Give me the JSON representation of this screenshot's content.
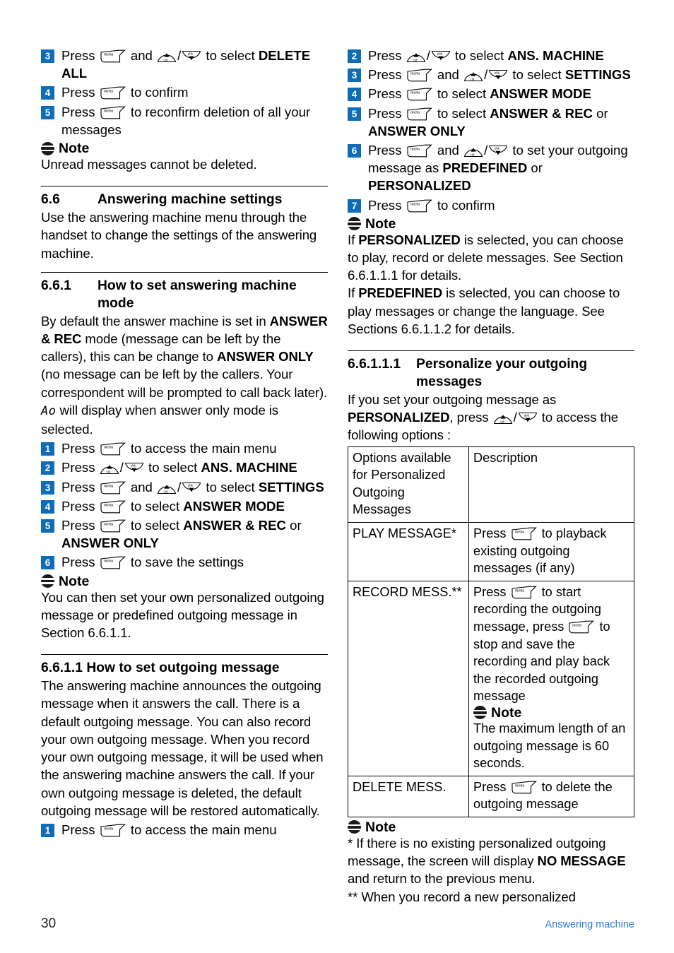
{
  "footer": {
    "page_number": "30",
    "section_label": "Answering machine"
  },
  "icons": {
    "menu_label": "menu",
    "up_label": "cid",
    "down_label": "pbk",
    "slash": "/",
    "note_label": "Note",
    "and": "and"
  },
  "left_column": {
    "steps_delete": [
      {
        "num": "3",
        "pre": "Press ",
        "mid": " and ",
        "post": " to select ",
        "bold": "DELETE ALL"
      },
      {
        "num": "4",
        "pre": "Press ",
        "post": " to confirm"
      },
      {
        "num": "5",
        "pre": "Press ",
        "post": " to reconfirm deletion of all your messages"
      }
    ],
    "note1": {
      "label": "Note",
      "text": "Unread messages cannot be deleted."
    },
    "section_6_6": {
      "number": "6.6",
      "title": "Answering machine settings",
      "body": "Use the answering machine menu through the handset to change the settings of the answering machine."
    },
    "section_6_6_1": {
      "number": "6.6.1",
      "title": "How to set answering machine mode",
      "p1_a": "By default the answer machine is set in ",
      "p1_b": "ANSWER & REC",
      "p1_c": " mode (message can be left by the callers), this can be change to ",
      "p1_d": "ANSWER ONLY",
      "p1_e": " (no message can be left by the callers. Your correspondent will be prompted to call back later).",
      "lcd_glyph": "Ao",
      "p2": " will display when answer only mode is selected."
    },
    "steps_mode": [
      {
        "num": "1",
        "pre": "Press ",
        "post": " to access the main menu"
      },
      {
        "num": "2",
        "pre": "Press ",
        "post": " to select ",
        "bold": "ANS. MACHINE"
      },
      {
        "num": "3",
        "pre": "Press ",
        "mid": " and ",
        "post": " to select ",
        "bold": "SETTINGS"
      },
      {
        "num": "4",
        "pre": "Press ",
        "post": " to select ",
        "bold": "ANSWER MODE"
      },
      {
        "num": "5",
        "pre": "Press ",
        "post": " to select ",
        "bold": "ANSWER & REC",
        "tail": " or ",
        "bold2": "ANSWER ONLY"
      },
      {
        "num": "6",
        "pre": "Press ",
        "post": " to save the settings"
      }
    ],
    "note2": {
      "label": "Note",
      "text": "You can then set your own personalized outgoing message or predefined outgoing message in Section 6.6.1.1."
    },
    "section_6_6_1_1": {
      "number": "6.6.1.1",
      "title": "How to set outgoing message",
      "body": "The answering machine announces the outgoing message when it answers the call. There is a default outgoing message. You can also record your own outgoing message. When you record your own outgoing message, it will be used when the answering machine answers the call. If your own outgoing message is deleted, the default outgoing message will be restored automatically."
    },
    "last_step": {
      "num": "1",
      "pre": "Press ",
      "post": " to access the main menu"
    }
  },
  "right_column": {
    "steps_cont": [
      {
        "num": "2",
        "pre": "Press ",
        "post": " to select ",
        "bold": "ANS. MACHINE"
      },
      {
        "num": "3",
        "pre": "Press ",
        "mid": " and ",
        "post": " to select ",
        "bold": "SETTINGS"
      },
      {
        "num": "4",
        "pre": "Press ",
        "post": " to select ",
        "bold": "ANSWER MODE"
      },
      {
        "num": "5",
        "pre": "Press ",
        "post": " to select ",
        "bold": "ANSWER & REC",
        "tail": " or ",
        "bold2": "ANSWER ONLY"
      },
      {
        "num": "6",
        "pre": "Press ",
        "mid": " and ",
        "post": " to set your outgoing message as ",
        "bold": "PREDEFINED",
        "tail": " or ",
        "bold2": "PERSONALIZED"
      },
      {
        "num": "7",
        "pre": "Press ",
        "post": " to confirm"
      }
    ],
    "note3": {
      "label": "Note",
      "l1_a": "If ",
      "l1_b": "PERSONALIZED",
      "l1_c": " is selected, you can choose to play, record or delete messages. See Section 6.6.1.1.1 for details.",
      "l2_a": "If ",
      "l2_b": "PREDEFINED",
      "l2_c": " is selected, you can choose to play messages or change the language. See Sections 6.6.1.1.2 for details."
    },
    "section_6_6_1_1_1": {
      "number": "6.6.1.1.1",
      "title": "Personalize your outgoing messages",
      "intro_a": "If you set your outgoing message as ",
      "intro_b": "PERSONALIZED",
      "intro_c": ", press ",
      "intro_d": " to access the following options :"
    },
    "table": {
      "header": {
        "col1": "Options available for Personalized Outgoing Messages",
        "col2": "Description"
      },
      "rows": [
        {
          "option": "PLAY MESSAGE*",
          "desc_pre": "Press ",
          "desc_post": " to playback existing outgoing messages (if any)"
        },
        {
          "option": "RECORD MESS.**",
          "desc_pre": "Press ",
          "desc_mid": " to start recording the outgoing message, press ",
          "desc_post": " to stop and save the recording and play back the recorded outgoing message",
          "note_label": "Note",
          "note_text": "The maximum length of an outgoing message is 60 seconds."
        },
        {
          "option": "DELETE MESS.",
          "desc_pre": "Press ",
          "desc_post": " to delete the outgoing message"
        }
      ]
    },
    "note4": {
      "label": "Note",
      "l1_a": "* If there is no existing personalized outgoing message, the screen will display ",
      "l1_b": "NO MESSAGE",
      "l1_c": " and return to the previous menu.",
      "l2": "** When you record a new personalized"
    }
  },
  "colors": {
    "step_badge": "#0f6cb6",
    "footer_link": "#2b7fd4",
    "text": "#000000"
  }
}
